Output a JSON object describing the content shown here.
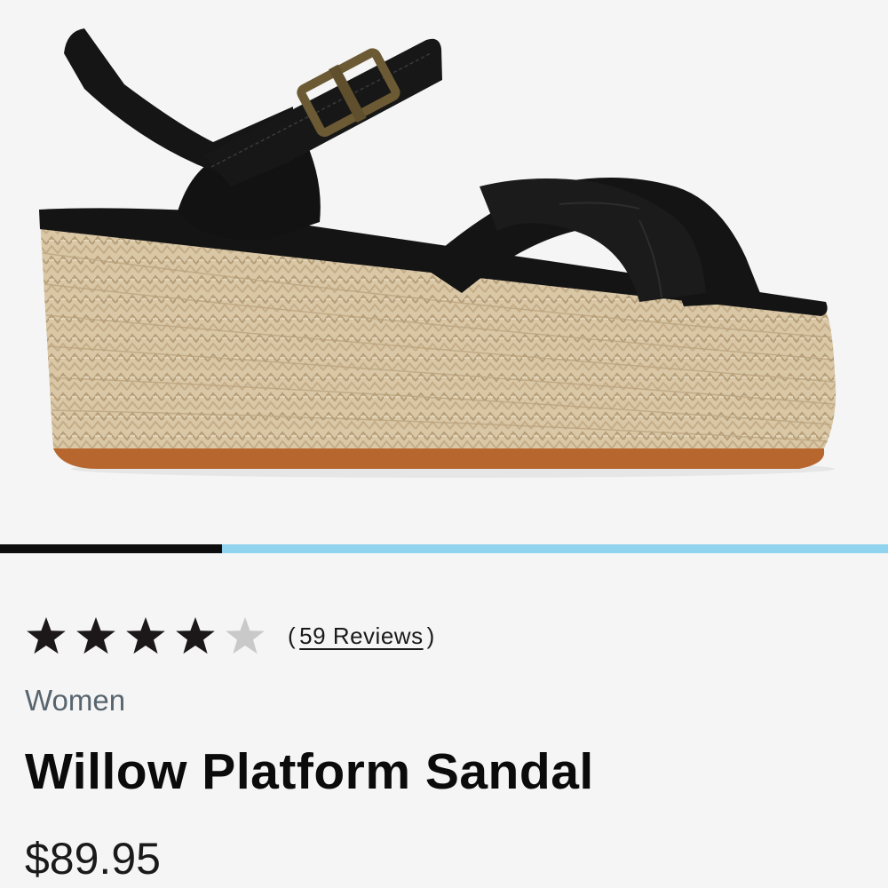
{
  "product": {
    "image_alt": "Black Willow Platform Sandal with jute espadrille wedge",
    "carousel": {
      "progress": 0.25
    },
    "rating": {
      "value": 4,
      "max": 5
    },
    "reviews": {
      "open": "(",
      "label": "59 Reviews",
      "close": ")"
    },
    "category": "Women",
    "title": "Willow Platform Sandal",
    "price": "$89.95"
  },
  "colors": {
    "background": "#f5f5f5",
    "star_filled": "#1c1718",
    "star_empty": "#c9c9c9",
    "progress_active": "#0d0d0d",
    "progress_track": "#8fd3ef",
    "category_text": "#58656f"
  },
  "icons": {
    "star": "star-icon"
  }
}
